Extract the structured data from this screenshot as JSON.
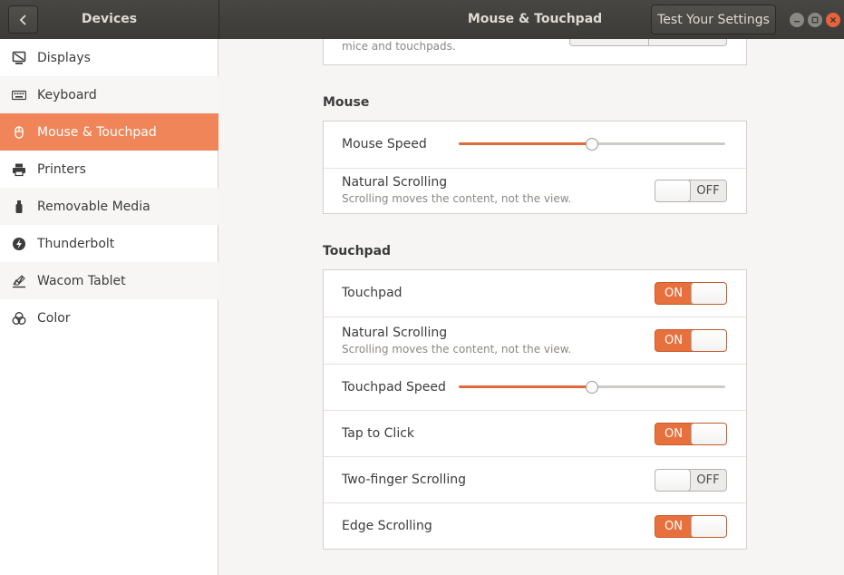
{
  "header": {
    "left_title": "Devices",
    "main_title": "Mouse & Touchpad",
    "test_button": "Test Your Settings"
  },
  "sidebar": {
    "items": [
      {
        "label": "Displays",
        "icon": "display-icon"
      },
      {
        "label": "Keyboard",
        "icon": "keyboard-icon"
      },
      {
        "label": "Mouse & Touchpad",
        "icon": "mouse-icon",
        "active": true
      },
      {
        "label": "Printers",
        "icon": "printer-icon"
      },
      {
        "label": "Removable Media",
        "icon": "usb-icon"
      },
      {
        "label": "Thunderbolt",
        "icon": "thunderbolt-icon"
      },
      {
        "label": "Wacom Tablet",
        "icon": "tablet-icon"
      },
      {
        "label": "Color",
        "icon": "color-icon"
      }
    ]
  },
  "general": {
    "partial_text": "mice and touchpads."
  },
  "mouse": {
    "section_title": "Mouse",
    "speed_label": "Mouse Speed",
    "speed_value": 0.5,
    "natural_scrolling_label": "Natural Scrolling",
    "natural_scrolling_sub": "Scrolling moves the content, not the view.",
    "natural_scrolling_state": "OFF"
  },
  "touchpad": {
    "section_title": "Touchpad",
    "touchpad_label": "Touchpad",
    "touchpad_state": "ON",
    "natural_scrolling_label": "Natural Scrolling",
    "natural_scrolling_sub": "Scrolling moves the content, not the view.",
    "natural_scrolling_state": "ON",
    "speed_label": "Touchpad Speed",
    "speed_value": 0.5,
    "tap_to_click_label": "Tap to Click",
    "tap_to_click_state": "ON",
    "two_finger_label": "Two-finger Scrolling",
    "two_finger_state": "OFF",
    "edge_scrolling_label": "Edge Scrolling",
    "edge_scrolling_state": "ON"
  },
  "colors": {
    "accent": "#e8703d",
    "sidebar_active": "#ef8559",
    "header_bg": "#3c3b37"
  }
}
